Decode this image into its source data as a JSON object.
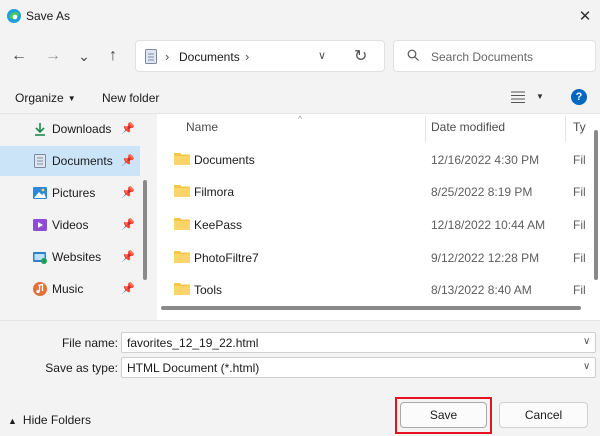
{
  "window": {
    "title": "Save As",
    "close_glyph": "✕"
  },
  "nav": {
    "back_glyph": "←",
    "forward_glyph": "→",
    "recent_glyph": "⌄",
    "up_glyph": "↑",
    "breadcrumb": "Documents",
    "refresh_glyph": "↻"
  },
  "search": {
    "placeholder": "Search Documents"
  },
  "toolbar": {
    "organize": "Organize",
    "new_folder": "New folder",
    "help": "?"
  },
  "sidebar": {
    "items": [
      {
        "label": "Downloads",
        "icon": "download-icon"
      },
      {
        "label": "Documents",
        "icon": "documents-icon"
      },
      {
        "label": "Pictures",
        "icon": "pictures-icon"
      },
      {
        "label": "Videos",
        "icon": "videos-icon"
      },
      {
        "label": "Websites",
        "icon": "websites-icon"
      },
      {
        "label": "Music",
        "icon": "music-icon"
      }
    ]
  },
  "files": {
    "headers": {
      "name": "Name",
      "date": "Date modified",
      "type": "Ty"
    },
    "rows": [
      {
        "name": "Documents",
        "date": "12/16/2022 4:30 PM",
        "type": "Fil"
      },
      {
        "name": "Filmora",
        "date": "8/25/2022 8:19 PM",
        "type": "Fil"
      },
      {
        "name": "KeePass",
        "date": "12/18/2022 10:44 AM",
        "type": "Fil"
      },
      {
        "name": "PhotoFiltre7",
        "date": "9/12/2022 12:28 PM",
        "type": "Fil"
      },
      {
        "name": "Tools",
        "date": "8/13/2022 8:40 AM",
        "type": "Fil"
      }
    ]
  },
  "form": {
    "file_name_label": "File name:",
    "file_name_value": "favorites_12_19_22.html",
    "save_as_type_label": "Save as type:",
    "save_as_type_value": "HTML Document (*.html)"
  },
  "footer": {
    "hide_folders": "Hide Folders",
    "save": "Save",
    "cancel": "Cancel"
  },
  "colors": {
    "selected_bg": "#cce4f7",
    "folder": "#f8c44a",
    "accent": "#0067c0",
    "highlight": "#e81123"
  }
}
